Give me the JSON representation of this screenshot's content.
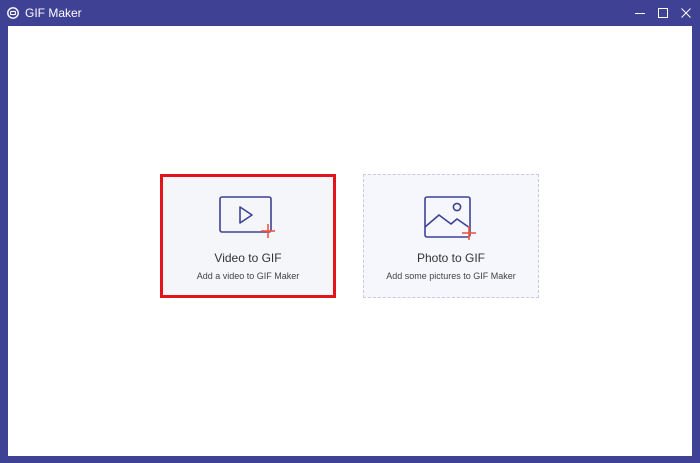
{
  "window": {
    "title": "GIF Maker",
    "colors": {
      "frame": "#3f4195",
      "accent_icon": "#3f4195",
      "plus": "#f0593e",
      "highlight_border": "#e3141c"
    }
  },
  "cards": {
    "video": {
      "title": "Video to GIF",
      "description": "Add a video to GIF Maker",
      "icon": "video-play-icon"
    },
    "photo": {
      "title": "Photo to GIF",
      "description": "Add some pictures to GIF Maker",
      "icon": "image-icon"
    }
  }
}
